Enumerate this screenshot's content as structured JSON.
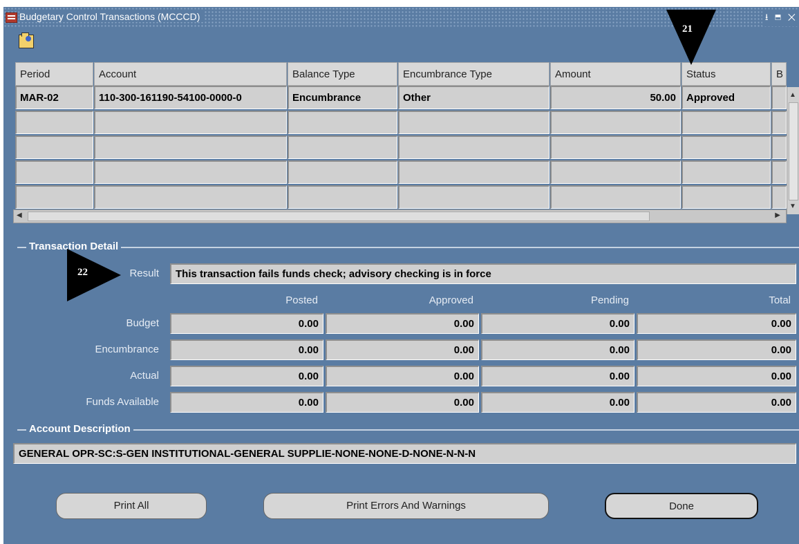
{
  "window": {
    "title": "Budgetary Control Transactions (MCCCD)",
    "controls": "⭳ ⬒ ✕"
  },
  "table": {
    "headers": [
      "Period",
      "Account",
      "Balance Type",
      "Encumbrance Type",
      "Amount",
      "Status",
      "B"
    ],
    "rows": [
      {
        "period": "MAR-02",
        "account": "110-300-161190-54100-0000-0",
        "balance_type": "Encumbrance",
        "encumbrance_type": "Other",
        "amount": "50.00",
        "status": "Approved"
      }
    ]
  },
  "transaction_detail": {
    "section_label": "Transaction Detail",
    "result_label": "Result",
    "result_value": "This transaction fails funds check; advisory checking is in force",
    "column_headers": [
      "Posted",
      "Approved",
      "Pending",
      "Total"
    ],
    "rows": [
      {
        "label": "Budget",
        "values": [
          "0.00",
          "0.00",
          "0.00",
          "0.00"
        ]
      },
      {
        "label": "Encumbrance",
        "values": [
          "0.00",
          "0.00",
          "0.00",
          "0.00"
        ]
      },
      {
        "label": "Actual",
        "values": [
          "0.00",
          "0.00",
          "0.00",
          "0.00"
        ]
      },
      {
        "label": "Funds Available",
        "values": [
          "0.00",
          "0.00",
          "0.00",
          "0.00"
        ]
      }
    ]
  },
  "account_description": {
    "section_label": "Account Description",
    "value": "GENERAL OPR-SC:S-GEN INSTITUTIONAL-GENERAL SUPPLIE-NONE-NONE-D-NONE-N-N-N"
  },
  "buttons": {
    "print_all": "Print All",
    "print_errors": "Print Errors And Warnings",
    "done": "Done"
  },
  "callouts": [
    "21",
    "22"
  ],
  "colors": {
    "window_bg": "#5a7ca3",
    "field_bg": "#d0d0d0",
    "header_bg": "#d8d8d8"
  }
}
